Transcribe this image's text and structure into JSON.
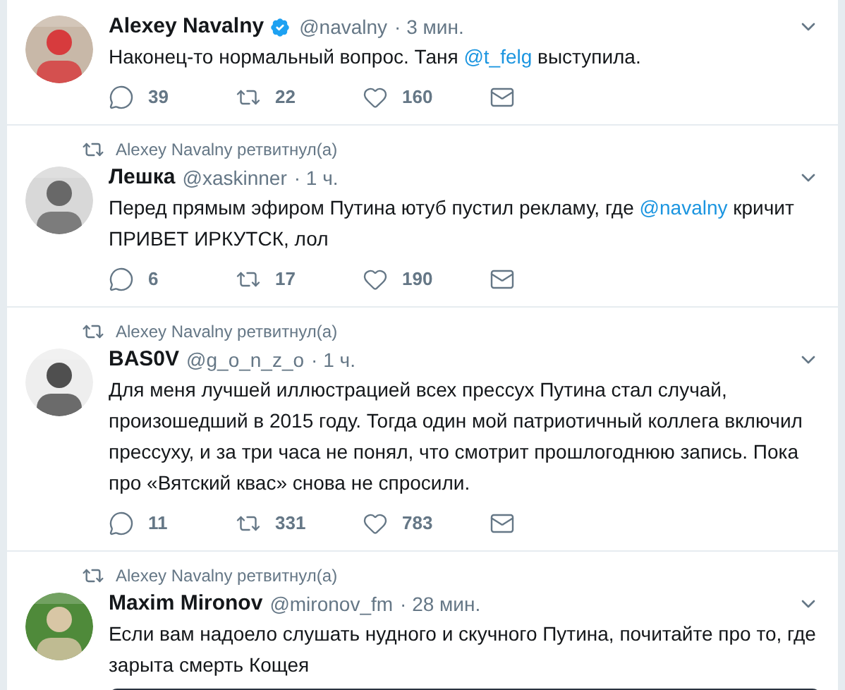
{
  "tweets": [
    {
      "name": "Alexey Navalny",
      "verified": true,
      "handle": "@navalny",
      "time": "· 3 мин.",
      "text": [
        {
          "kind": "plain",
          "text": "Наконец-то нормальный вопрос. Таня "
        },
        {
          "kind": "mention",
          "text": "@t_felg"
        },
        {
          "kind": "plain",
          "text": " выступила."
        }
      ],
      "actions": {
        "replies": "39",
        "retweets": "22",
        "likes": "160"
      }
    },
    {
      "retweeted_by": "Alexey Navalny ретвитнул(а)",
      "name": "Лешка",
      "verified": false,
      "handle": "@xaskinner",
      "time": "· 1 ч.",
      "text": [
        {
          "kind": "plain",
          "text": "Перед прямым эфиром Путина ютуб пустил рекламу, где "
        },
        {
          "kind": "mention",
          "text": "@navalny"
        },
        {
          "kind": "plain",
          "text": " кричит ПРИВЕТ ИРКУТСК, лол"
        }
      ],
      "actions": {
        "replies": "6",
        "retweets": "17",
        "likes": "190"
      }
    },
    {
      "retweeted_by": "Alexey Navalny ретвитнул(а)",
      "name": "BAS0V",
      "verified": false,
      "handle": "@g_o_n_z_o",
      "time": "· 1 ч.",
      "text": [
        {
          "kind": "plain",
          "text": "Для меня лучшей иллюстрацией всех прессух Путина стал случай, произошедший в 2015 году. Тогда один мой патриотичный коллега включил прессуху, и за три часа не понял, что смотрит прошлогоднюю запись. Пока про «Вятский квас» снова не спросили."
        }
      ],
      "actions": {
        "replies": "11",
        "retweets": "331",
        "likes": "783"
      }
    },
    {
      "retweeted_by": "Alexey Navalny ретвитнул(а)",
      "name": "Maxim Mironov",
      "verified": false,
      "handle": "@mironov_fm",
      "time": "· 28 мин.",
      "text": [
        {
          "kind": "plain",
          "text": "Если вам надоело слушать нудного и скучного Путина, почитайте про то, где зарыта смерть Кощея"
        }
      ]
    }
  ]
}
